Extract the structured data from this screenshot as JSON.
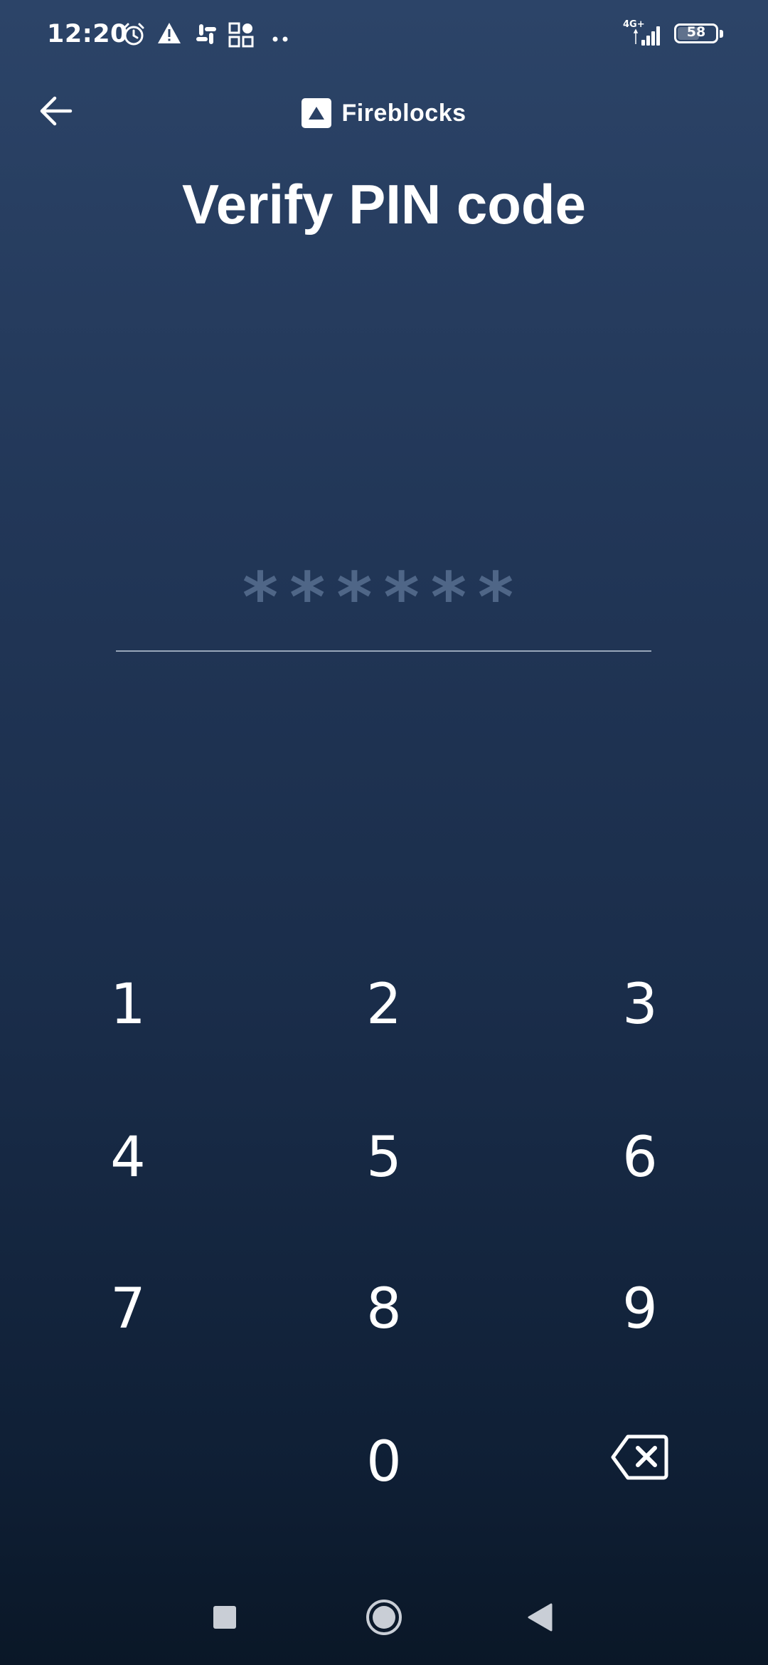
{
  "status_bar": {
    "time": "12:20",
    "network": "4G+",
    "battery": "58",
    "battery_level": 0.58,
    "icons": [
      "alarm-icon",
      "warning-icon",
      "slack-icon",
      "apps-icon",
      "more-dots-icon",
      "signal-icon",
      "battery-icon"
    ]
  },
  "header": {
    "back_icon": "arrow-left-icon",
    "brand_name": "Fireblocks",
    "brand_icon": "fireblocks-logo-icon"
  },
  "page": {
    "title": "Verify PIN code"
  },
  "pin": {
    "mask": "******",
    "length": 6
  },
  "keypad": {
    "keys": [
      "1",
      "2",
      "3",
      "4",
      "5",
      "6",
      "7",
      "8",
      "9",
      "0"
    ],
    "delete_icon": "backspace-icon"
  },
  "nav_bar": {
    "icons": [
      "recents-square-icon",
      "home-circle-icon",
      "back-triangle-icon"
    ]
  },
  "colors": {
    "background_top": "#2c4468",
    "background_bottom": "#0a1727",
    "pin_placeholder": "#4f6687",
    "underline": "#98a6b9",
    "text": "#ffffff"
  }
}
